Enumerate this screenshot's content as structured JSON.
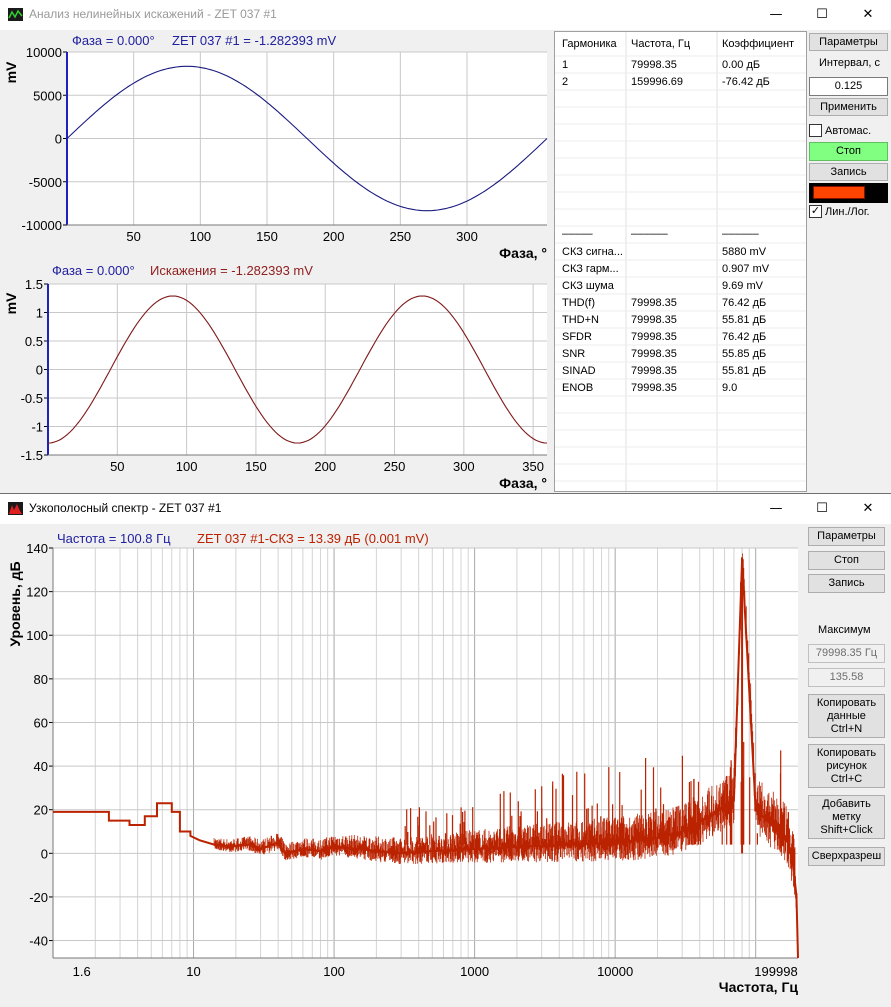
{
  "window1": {
    "title": "Анализ нелинейных искажений - ZET 037 #1",
    "minimize": "—",
    "maximize": "☐",
    "close": "✕"
  },
  "chart1": {
    "cursor_label": "Фаза = 0.000°",
    "channel_label": "ZET 037 #1 = -1.282393 mV",
    "ylabel": "mV",
    "xlabel": "Фаза, °",
    "yticks": [
      "10000",
      "5000",
      "0",
      "-5000",
      "-10000"
    ],
    "xticks": [
      "50",
      "100",
      "150",
      "200",
      "250",
      "300"
    ]
  },
  "chart2": {
    "cursor_label": "Фаза = 0.000°",
    "channel_label": "Искажения = -1.282393 mV",
    "ylabel": "mV",
    "xlabel": "Фаза, °",
    "yticks": [
      "1.5",
      "1",
      "0.5",
      "0",
      "-0.5",
      "-1",
      "-1.5"
    ],
    "xticks": [
      "50",
      "100",
      "150",
      "200",
      "250",
      "300",
      "350"
    ]
  },
  "chart_data": [
    {
      "type": "line",
      "title": "",
      "xlabel": "Фаза, °",
      "ylabel": "mV",
      "xlim": [
        0,
        360
      ],
      "ylim": [
        -10000,
        10000
      ],
      "series": [
        {
          "name": "ZET 037 #1",
          "function": "amplitude*sin(x)",
          "amplitude": 8350,
          "color": "#1a1a80"
        }
      ]
    },
    {
      "type": "line",
      "title": "",
      "xlabel": "Фаза, °",
      "ylabel": "mV",
      "xlim": [
        0,
        360
      ],
      "ylim": [
        -1.5,
        1.5
      ],
      "series": [
        {
          "name": "Искажения",
          "function": "-amplitude*cos(2x)",
          "amplitude": 1.29,
          "color": "#801a1a"
        }
      ]
    },
    {
      "type": "line",
      "title": "",
      "xlabel": "Частота, Гц",
      "ylabel": "Уровень, дБ",
      "xscale": "log",
      "xlim": [
        1,
        199998
      ],
      "ylim": [
        -48,
        140
      ],
      "series": [
        {
          "name": "ZET 037 #1-СКЗ",
          "color": "#bb2200",
          "x": [
            1,
            2.5,
            2.5,
            3.5,
            3.5,
            4.5,
            4.5,
            5.5,
            5.5,
            7,
            7,
            8,
            8,
            9.5,
            9.5,
            11,
            14,
            18,
            25,
            30,
            40,
            45,
            60,
            80,
            100,
            150,
            200,
            300,
            500,
            1000,
            2000,
            5000,
            10000,
            20000,
            30000,
            50000,
            70000,
            79998,
            100000,
            120000,
            150000,
            170000,
            185000,
            195000,
            199998
          ],
          "values": [
            19,
            19,
            15,
            15,
            13,
            13,
            17,
            17,
            23,
            23,
            19,
            19,
            10,
            10,
            8,
            6,
            4,
            3,
            4,
            2,
            5,
            0,
            2,
            1,
            3,
            2,
            1,
            0,
            1,
            2,
            3,
            4,
            5,
            7,
            10,
            18,
            24,
            135,
            20,
            15,
            10,
            5,
            -5,
            -20,
            -48
          ]
        }
      ],
      "peaks": [
        {
          "x": 79998.35,
          "y": 135.58
        }
      ]
    }
  ],
  "table": {
    "headers": [
      "Гармоника",
      "Частота, Гц",
      "Коэффициент"
    ],
    "harmonics": [
      [
        "1",
        "79998.35",
        "0.00 дБ"
      ],
      [
        "2",
        "159996.69",
        "-76.42 дБ"
      ]
    ],
    "separator": [
      "–––––",
      "––––––",
      "––––––"
    ],
    "stats": [
      [
        "СКЗ сигна...",
        "",
        "5880 mV"
      ],
      [
        "СКЗ гарм...",
        "",
        "0.907 mV"
      ],
      [
        "СКЗ шума",
        "",
        "9.69 mV"
      ],
      [
        "THD(f)",
        "79998.35",
        "76.42 дБ"
      ],
      [
        "THD+N",
        "79998.35",
        "55.81 дБ"
      ],
      [
        "SFDR",
        "79998.35",
        "76.42 дБ"
      ],
      [
        "SNR",
        "79998.35",
        "55.85 дБ"
      ],
      [
        "SINAD",
        "79998.35",
        "55.81 дБ"
      ],
      [
        "ENOB",
        "79998.35",
        "9.0"
      ]
    ]
  },
  "controls1": {
    "params": "Параметры",
    "interval_label": "Интервал, с",
    "interval_value": "0.125",
    "apply": "Применить",
    "autoscale": "Автомас.",
    "autoscale_checked": false,
    "stop": "Стоп",
    "stop_color": "#80ff80",
    "record": "Запись",
    "record_indicator": "#ff4400",
    "linlog": "Лин./Лог.",
    "linlog_checked": true,
    "check_glyph": "✓"
  },
  "window2": {
    "title": "Узкополосный спектр - ZET 037 #1",
    "minimize": "—",
    "maximize": "☐",
    "close": "✕"
  },
  "chart3": {
    "cursor_label": "Частота = 100.8 Гц",
    "channel_label": "ZET 037 #1-СКЗ = 13.39 дБ (0.001 mV)",
    "ylabel": "Уровень, дБ",
    "xlabel": "Частота, Гц",
    "yticks": [
      "140",
      "120",
      "100",
      "80",
      "60",
      "40",
      "20",
      "0",
      "-20",
      "-40"
    ],
    "xticks": [
      "1.6",
      "10",
      "100",
      "1000",
      "10000",
      "199998"
    ]
  },
  "controls2": {
    "params": "Параметры",
    "stop": "Стоп",
    "record": "Запись",
    "max_label": "Максимум",
    "max_freq": "79998.35 Гц",
    "max_value": "135.58",
    "copy_data": [
      "Копировать",
      "данные",
      "Ctrl+N"
    ],
    "copy_image": [
      "Копировать",
      "рисунок",
      "Ctrl+C"
    ],
    "add_mark": [
      "Добавить",
      "метку",
      "Shift+Click"
    ],
    "superres": "Сверхразреш"
  }
}
